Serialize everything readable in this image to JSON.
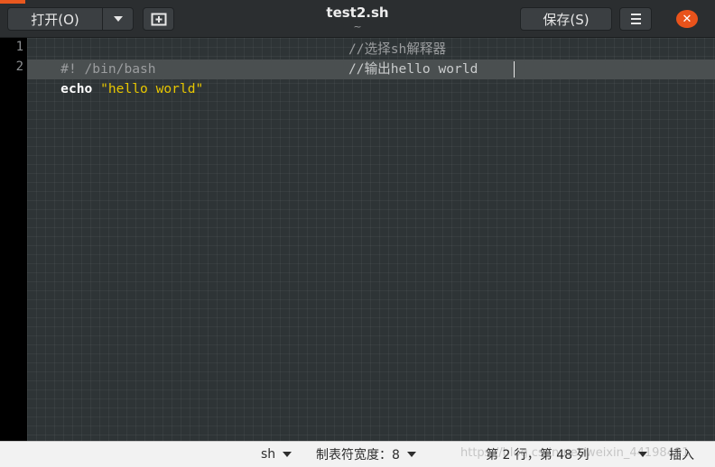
{
  "header": {
    "open_label": "打开(O)",
    "title": "test2.sh",
    "subtitle": "~",
    "save_label": "保存(S)",
    "close_glyph": "✕"
  },
  "icons": {
    "open_arrow": "chevron-down-icon",
    "new_tab": "new-tab-icon",
    "menu": "hamburger-menu-icon",
    "close": "close-icon"
  },
  "editor": {
    "line_numbers": [
      "1",
      "2"
    ],
    "lines": [
      {
        "shebang": "#! /bin/bash",
        "comment": "//选择sh解释器"
      },
      {
        "keyword": "echo",
        "string": "\"hello world\"",
        "comment": "//输出hello world"
      }
    ]
  },
  "statusbar": {
    "language": "sh",
    "tab_width_label": "制表符宽度：",
    "tab_width_value": "8",
    "position": "第 2 行，第 48 列",
    "mode": "插入",
    "watermark": "https://blog.csdn.net/weixin_44198491"
  },
  "colors": {
    "accent": "#e9531b",
    "editor_bg": "#2e3436",
    "string": "#e7c600",
    "comment": "#9b9d9f"
  }
}
